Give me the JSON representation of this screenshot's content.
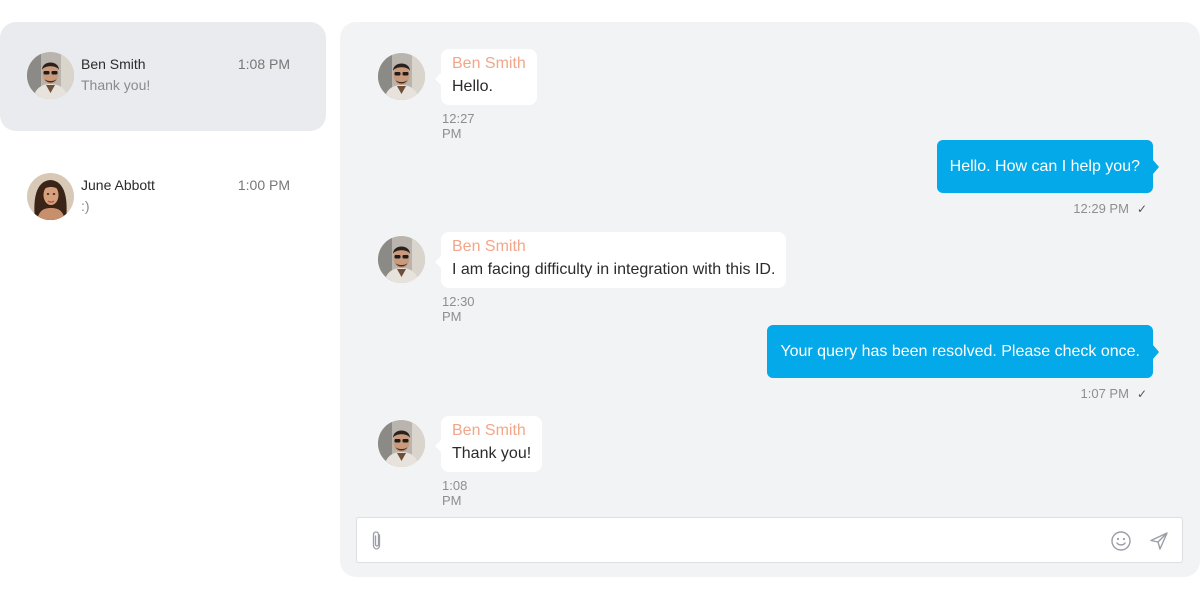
{
  "conversations": [
    {
      "name": "Ben Smith",
      "time": "1:08 PM",
      "preview": "Thank you!",
      "active": true
    },
    {
      "name": "June Abbott",
      "time": "1:00 PM",
      "preview": ":)",
      "active": false
    }
  ],
  "messages": [
    {
      "direction": "in",
      "sender": "Ben Smith",
      "text": "Hello.",
      "time": "12:27 PM"
    },
    {
      "direction": "out",
      "text": "Hello. How can I help you?",
      "time": "12:29 PM",
      "status": "✓"
    },
    {
      "direction": "in",
      "sender": "Ben Smith",
      "text": "I am facing difficulty in integration with this ID.",
      "time": "12:30 PM"
    },
    {
      "direction": "out",
      "text": "Your query has been resolved. Please check once.",
      "time": "1:07 PM",
      "status": "✓"
    },
    {
      "direction": "in",
      "sender": "Ben Smith",
      "text": "Thank you!",
      "time": "1:08 PM"
    }
  ],
  "composer": {
    "value": "",
    "placeholder": ""
  },
  "icons": {
    "attach": "paperclip-icon",
    "emoji": "smiley-icon",
    "send": "paper-plane-icon"
  },
  "colors": {
    "accent": "#03a9e8",
    "sender_name": "#f2a68a",
    "active_conversation": "#e9ebee",
    "chat_background": "#f2f3f5"
  }
}
